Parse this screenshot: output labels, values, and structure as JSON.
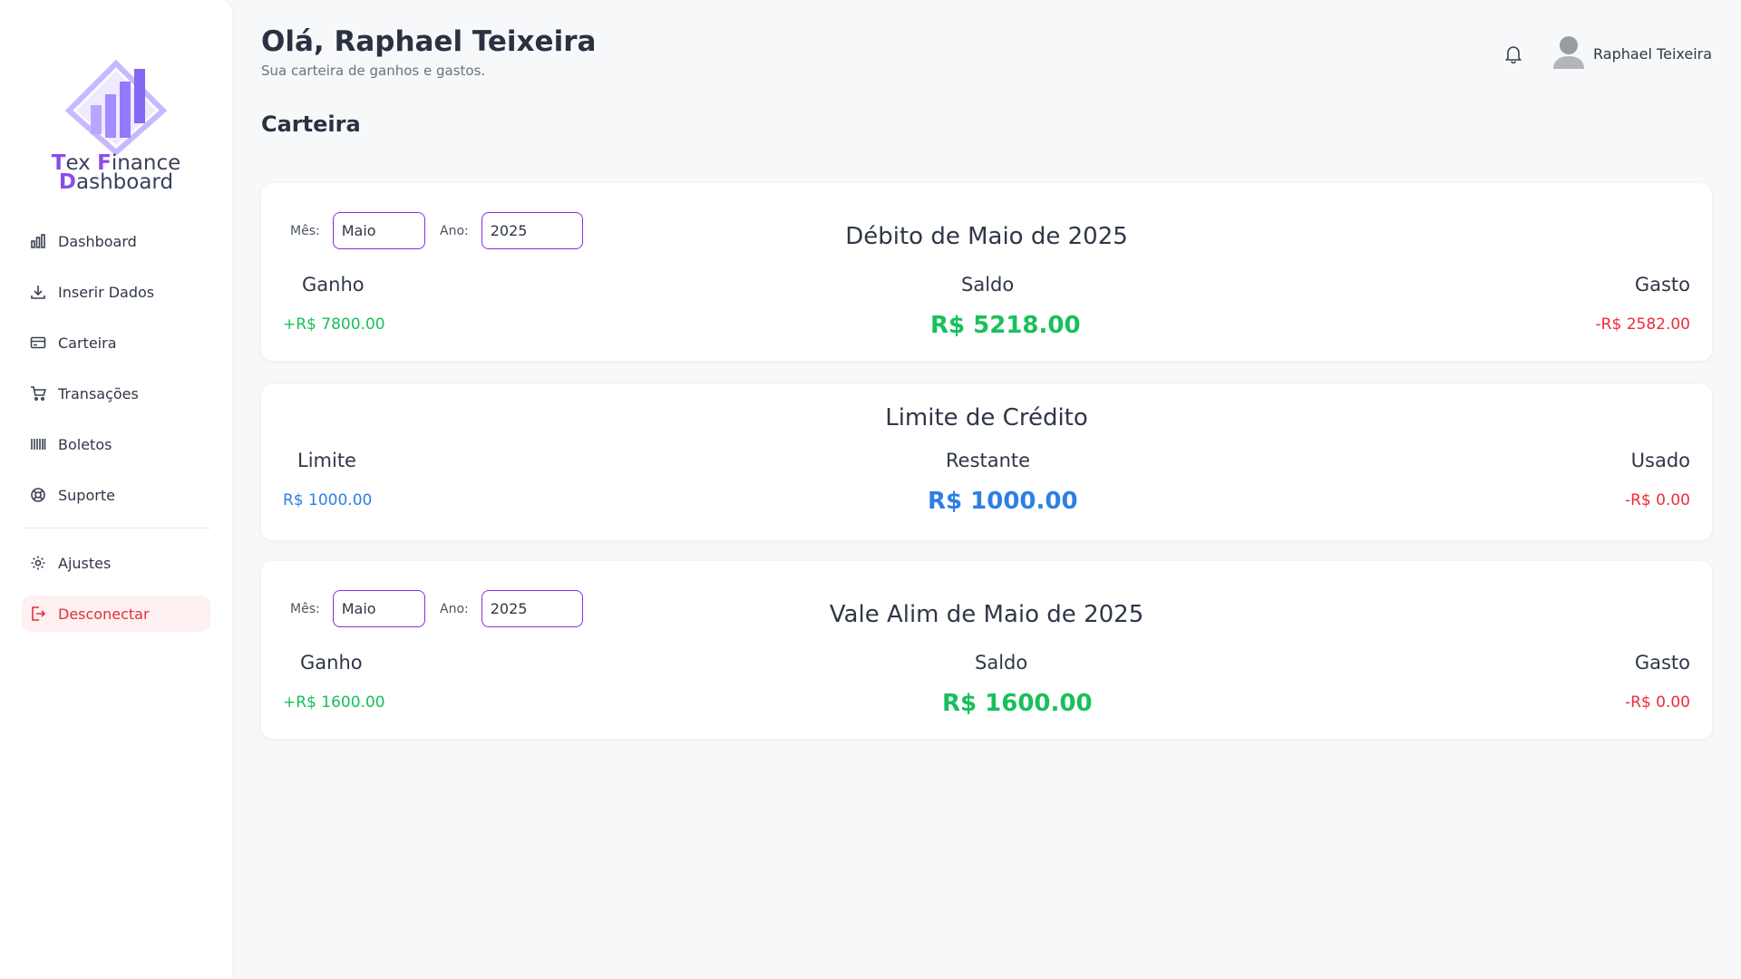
{
  "app": {
    "logo_line1_a": "T",
    "logo_line1_b": "ex ",
    "logo_line1_c": "F",
    "logo_line1_d": "inance",
    "logo_line2_a": "D",
    "logo_line2_b": "ashboard"
  },
  "sidebar": {
    "items": [
      {
        "label": "Dashboard",
        "icon": "bar-chart-icon"
      },
      {
        "label": "Inserir Dados",
        "icon": "download-icon"
      },
      {
        "label": "Carteira",
        "icon": "credit-card-icon"
      },
      {
        "label": "Transações",
        "icon": "cart-icon"
      },
      {
        "label": "Boletos",
        "icon": "barcode-icon"
      },
      {
        "label": "Suporte",
        "icon": "lifebuoy-icon"
      }
    ],
    "settings_label": "Ajustes",
    "logout_label": "Desconectar"
  },
  "header": {
    "greeting": "Olá, Raphael Teixeira",
    "subtitle": "Sua carteira de ganhos e gastos.",
    "user_name": "Raphael Teixeira"
  },
  "page": {
    "title": "Carteira"
  },
  "debit_card": {
    "title": "Débito de Maio de 2025",
    "month_label": "Mês:",
    "month_value": "Maio",
    "year_label": "Ano:",
    "year_value": "2025",
    "gain_label": "Ganho",
    "gain_value": "+R$ 7800.00",
    "balance_label": "Saldo",
    "balance_value": "R$ 5218.00",
    "spent_label": "Gasto",
    "spent_value": "-R$ 2582.00"
  },
  "credit_card": {
    "title": "Limite de Crédito",
    "limit_label": "Limite",
    "limit_value": "R$ 1000.00",
    "remaining_label": "Restante",
    "remaining_value": "R$ 1000.00",
    "used_label": "Usado",
    "used_value": "-R$ 0.00"
  },
  "meal_card": {
    "title": "Vale Alim de Maio de 2025",
    "month_label": "Mês:",
    "month_value": "Maio",
    "year_label": "Ano:",
    "year_value": "2025",
    "gain_label": "Ganho",
    "gain_value": "+R$ 1600.00",
    "balance_label": "Saldo",
    "balance_value": "R$ 1600.00",
    "spent_label": "Gasto",
    "spent_value": "-R$ 0.00"
  },
  "colors": {
    "accent": "#8a4dea",
    "positive": "#18c05a",
    "negative": "#ef2b38",
    "info": "#2d7fe6"
  }
}
